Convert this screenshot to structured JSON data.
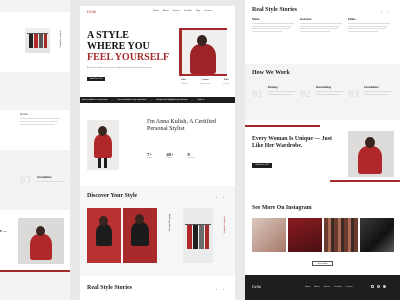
{
  "brand": {
    "logo": "Gelià",
    "accent": "#a52a2a",
    "dark": "#1e1e1e"
  },
  "nav": {
    "items": [
      "Home",
      "About",
      "Service",
      "Portfolio",
      "Blog",
      "Contact"
    ]
  },
  "hero": {
    "line1": "A STYLE",
    "line2": "WHERE YOU",
    "line3": "FEEL YOURSELF",
    "subtitle": "A style that reflects who you are. I'll help you find the look that feels truly yours.",
    "cta": "Book Free Call",
    "stats": [
      {
        "value": "100+",
        "label": "Clients"
      },
      {
        "value": "7 years",
        "label": "Experience"
      },
      {
        "value": "500+",
        "label": "Looks"
      }
    ]
  },
  "ticker": {
    "items": [
      "Feel confident in every look",
      "Your wardrobe is my inspiration",
      "A style that highlights your beauty",
      "Style is"
    ]
  },
  "about": {
    "title": "I'm Anna Kulish, A Certified Personal Stylist",
    "stats": [
      {
        "value": "7+",
        "label": "years"
      },
      {
        "value": "40+",
        "label": "clients"
      },
      {
        "value": "9",
        "label": "courses"
      }
    ]
  },
  "discover": {
    "title": "Discover Your Style",
    "vertical_labels": [
      "Wardrobe Analysis",
      "Personal Shopping"
    ]
  },
  "stories": {
    "title": "Real Style Stories",
    "people": [
      "Maria",
      "Kateryna",
      "Polina"
    ]
  },
  "how": {
    "title": "How We Work",
    "steps": [
      {
        "num": "01",
        "label": "Booking"
      },
      {
        "num": "02",
        "label": "Dressmaking"
      },
      {
        "num": "03",
        "label": "Consultation"
      }
    ]
  },
  "unique": {
    "title": "Every Woman Is Unique — Just Like Her Wardrobe.",
    "cta": "Book Free Call"
  },
  "instagram": {
    "title": "See More On Instagram",
    "button": "Go to profile"
  },
  "footer": {
    "logo": "Gelià",
    "links": [
      "Home",
      "About",
      "Service",
      "Portfolio",
      "Contact"
    ]
  },
  "left_col": {
    "name_top": "Polina",
    "step": "03",
    "step_label": "Consultation",
    "vert_label": "Wardrobe Analysis"
  }
}
